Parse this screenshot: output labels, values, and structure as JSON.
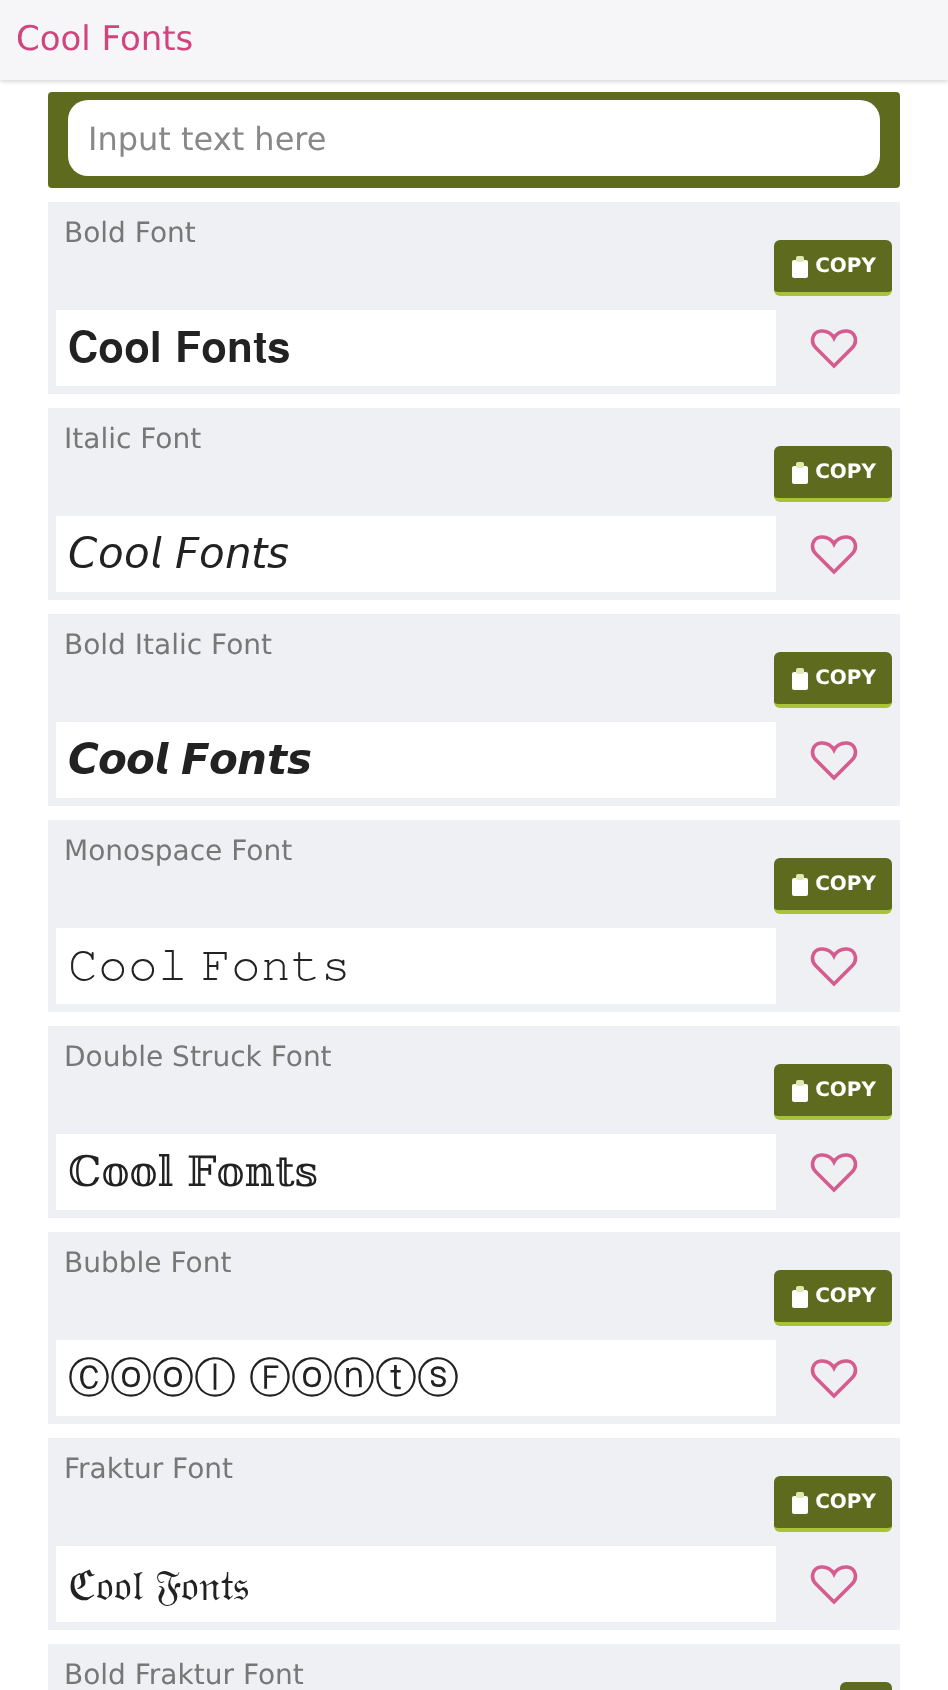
{
  "app_bar": {
    "title": "Cool Fonts"
  },
  "input": {
    "placeholder": "Input text here"
  },
  "fonts": [
    {
      "label": "Bold Font",
      "sample": "𝐂𝐨𝐨𝐥 𝐅𝐨𝐧𝐭𝐬",
      "copy": "COPY",
      "favorite": false
    },
    {
      "label": "Italic Font",
      "sample": "𝘊𝘰𝘰𝘭 𝘍𝘰𝘯𝘵𝘴",
      "copy": "COPY",
      "favorite": false
    },
    {
      "label": "Bold Italic Font",
      "sample": "𝘾𝙤𝙤𝙡 𝙁𝙤𝙣𝙩𝙨",
      "copy": "COPY",
      "favorite": false
    },
    {
      "label": "Monospace Font",
      "sample": "𝙲𝚘𝚘𝚕 𝙵𝚘𝚗𝚝𝚜",
      "copy": "COPY",
      "favorite": false
    },
    {
      "label": "Double Struck Font",
      "sample": "ℂ𝕠𝕠𝕝 𝔽𝕠𝕟𝕥𝕤",
      "copy": "COPY",
      "favorite": false
    },
    {
      "label": "Bubble Font",
      "sample": "Ⓒⓞⓞⓛ Ⓕⓞⓝⓣⓢ",
      "copy": "COPY",
      "favorite": false
    },
    {
      "label": "Fraktur Font",
      "sample": "ℭ𝔬𝔬𝔩 𝔉𝔬𝔫𝔱𝔰",
      "copy": "COPY",
      "favorite": false
    },
    {
      "label": "Bold Fraktur Font"
    }
  ]
}
